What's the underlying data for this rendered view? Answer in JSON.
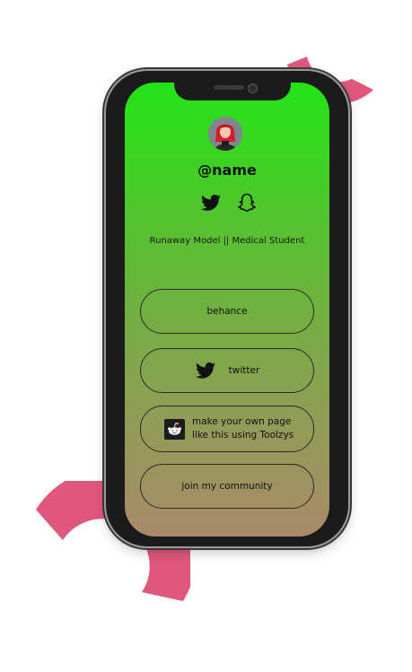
{
  "profile": {
    "handle": "@name",
    "bio": "Runaway Model || Medical Student",
    "avatar_icon": "avatar-photo"
  },
  "socials": [
    {
      "icon": "twitter-icon"
    },
    {
      "icon": "snapchat-icon"
    }
  ],
  "links": [
    {
      "label": "behance",
      "icon": ""
    },
    {
      "label": "twitter",
      "icon": "twitter-icon"
    },
    {
      "label": "make your own page\nlike this using Toolzys",
      "icon": "reddit-icon"
    },
    {
      "label": "join my community",
      "icon": ""
    }
  ],
  "colors": {
    "gradient_top": "#22e418",
    "gradient_bottom": "#a98a6a",
    "accent_arc": "#e0577e",
    "phone_frame": "#1b1b1b"
  }
}
